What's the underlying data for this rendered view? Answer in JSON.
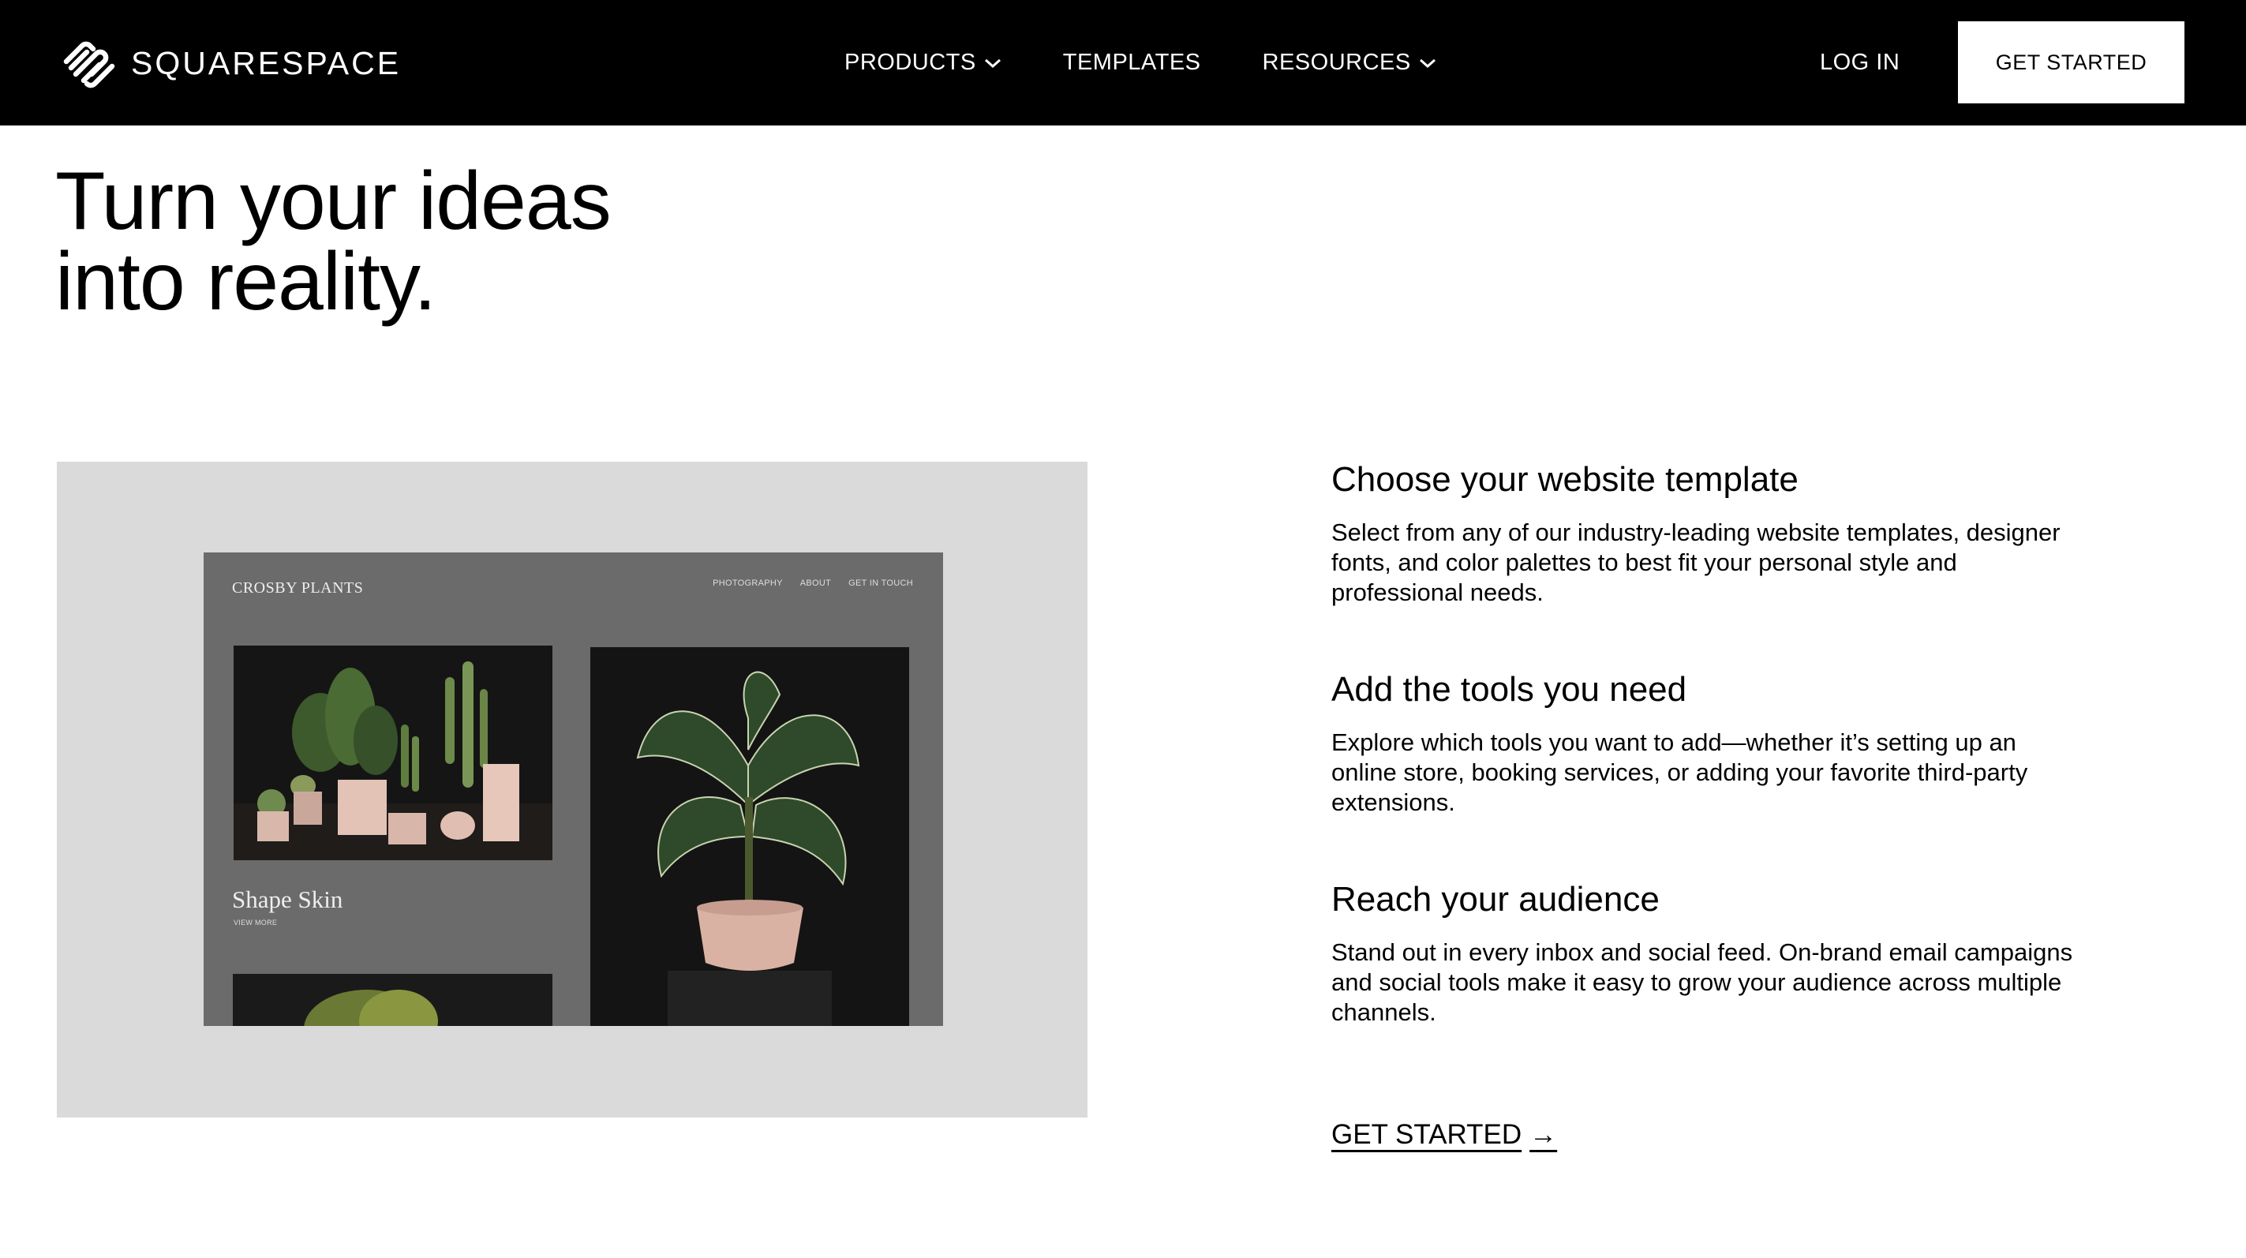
{
  "nav": {
    "brand": "SQUARESPACE",
    "logo_icon": "squarespace-logo-icon",
    "links": [
      {
        "label": "PRODUCTS",
        "icon": "chevron-down-icon"
      },
      {
        "label": "TEMPLATES"
      },
      {
        "label": "RESOURCES",
        "icon": "chevron-down-icon"
      }
    ],
    "login_label": "LOG IN",
    "cta_label": "GET STARTED"
  },
  "hero": {
    "title_line1": "Turn your ideas",
    "title_line2": "into reality."
  },
  "preview": {
    "brand": "CROSBY PLANTS",
    "nav_items": [
      "PHOTOGRAPHY",
      "ABOUT",
      "GET IN TOUCH"
    ],
    "caption": "Shape Skin",
    "caption_link": "VIEW MORE"
  },
  "features": [
    {
      "title": "Choose your website template",
      "description": "Select from any of our industry-leading website templates, designer fonts, and color palettes to best fit your personal style and professional needs."
    },
    {
      "title": "Add the tools you need",
      "description": "Explore which tools you want to add—whether it’s setting up an online store, booking services, or adding your favorite third-party extensions."
    },
    {
      "title": "Reach your audience",
      "description": "Stand out in every inbox and social feed. On-brand email campaigns and social tools make it easy to grow your audience across multiple channels."
    }
  ],
  "cta_link": {
    "label": "GET STARTED",
    "arrow": "→",
    "icon": "arrow-right-icon"
  },
  "colors": {
    "nav_bg": "#000000",
    "page_bg": "#ffffff",
    "preview_bg": "#dadada",
    "mock_bg": "#6b6b6b"
  }
}
